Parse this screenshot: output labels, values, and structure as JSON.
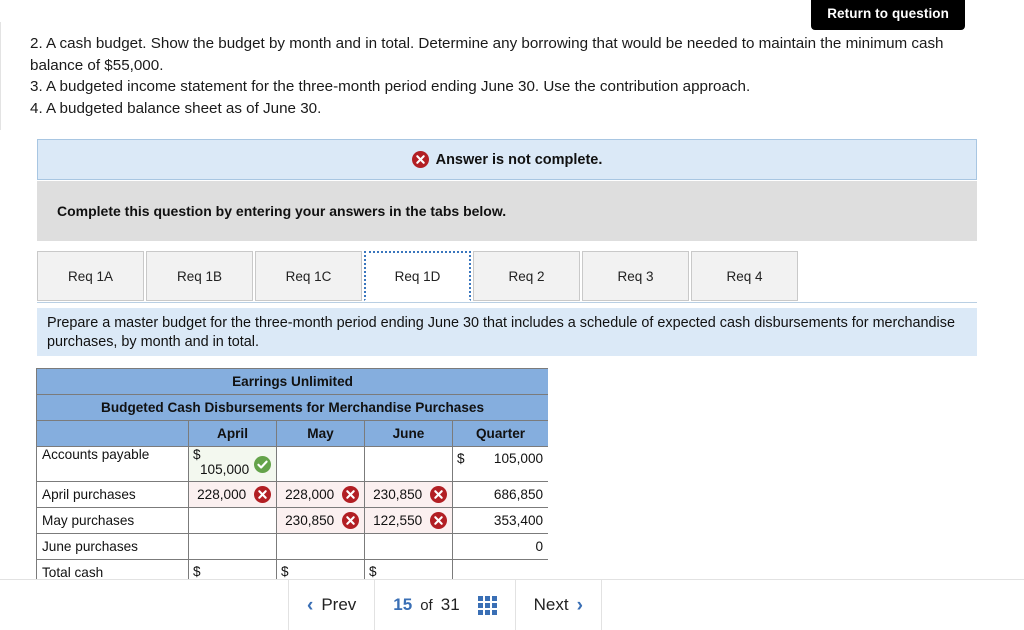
{
  "header": {
    "return_button": "Return to question"
  },
  "question": {
    "lines": [
      "2. A cash budget. Show the budget by month and in total. Determine any borrowing that would be needed to maintain the minimum cash balance of $55,000.",
      "3. A budgeted income statement for the three-month period ending June 30. Use the contribution approach.",
      "4. A budgeted balance sheet as of June 30."
    ]
  },
  "status_banner": {
    "icon": "error-circle-icon",
    "text": "Answer is not complete."
  },
  "instruction_gray": {
    "text": "Complete this question by entering your answers in the tabs below."
  },
  "tabs": {
    "items": [
      {
        "label": "Req 1A",
        "active": false
      },
      {
        "label": "Req 1B",
        "active": false
      },
      {
        "label": "Req 1C",
        "active": false
      },
      {
        "label": "Req 1D",
        "active": true
      },
      {
        "label": "Req 2",
        "active": false
      },
      {
        "label": "Req 3",
        "active": false
      },
      {
        "label": "Req 4",
        "active": false
      }
    ]
  },
  "requirement_box": {
    "text": "Prepare a master budget for the three-month period ending June 30 that includes a schedule of expected cash disbursements for merchandise purchases, by month and in total."
  },
  "budget_table": {
    "company": "Earrings Unlimited",
    "subtitle": "Budgeted Cash Disbursements for Merchandise Purchases",
    "columns": [
      "",
      "April",
      "May",
      "June",
      "Quarter"
    ],
    "rows": [
      {
        "label": "Accounts payable",
        "april": {
          "dollar": "$",
          "value": "105,000",
          "mark": "correct"
        },
        "may": {
          "value": ""
        },
        "june": {
          "value": ""
        },
        "quarter": {
          "dollar": "$",
          "value": "105,000"
        }
      },
      {
        "label": "April purchases",
        "april": {
          "value": "228,000",
          "mark": "wrong"
        },
        "may": {
          "value": "228,000",
          "mark": "wrong"
        },
        "june": {
          "value": "230,850",
          "mark": "wrong"
        },
        "quarter": {
          "value": "686,850"
        }
      },
      {
        "label": "May purchases",
        "april": {
          "value": ""
        },
        "may": {
          "value": "230,850",
          "mark": "wrong"
        },
        "june": {
          "value": "122,550",
          "mark": "wrong"
        },
        "quarter": {
          "value": "353,400"
        }
      },
      {
        "label": "June purchases",
        "april": {
          "value": ""
        },
        "may": {
          "value": ""
        },
        "june": {
          "value": ""
        },
        "quarter": {
          "value": "0"
        }
      },
      {
        "label": "Total cash",
        "april": {
          "dollar": "$",
          "value": ""
        },
        "may": {
          "dollar": "$",
          "value": ""
        },
        "june": {
          "dollar": "$",
          "value": ""
        },
        "quarter": {
          "value": ""
        }
      }
    ]
  },
  "bottom_nav": {
    "prev_label": "Prev",
    "prev_icon": "chevron-left-icon",
    "page_current": "15",
    "page_of": "of",
    "page_total": "31",
    "grid_icon": "grid-menu-icon",
    "next_label": "Next",
    "next_icon": "chevron-right-icon"
  },
  "colors": {
    "banner_bg": "#dbe9f7",
    "gray_bg": "#dedede",
    "table_header_blue": "#85aede",
    "accent_blue": "#3a6fb5",
    "error_red": "#b21f24",
    "success_green": "#64a34a",
    "wrong_cell_bg": "#fbf0f0",
    "right_cell_bg": "#f3f8ef"
  }
}
